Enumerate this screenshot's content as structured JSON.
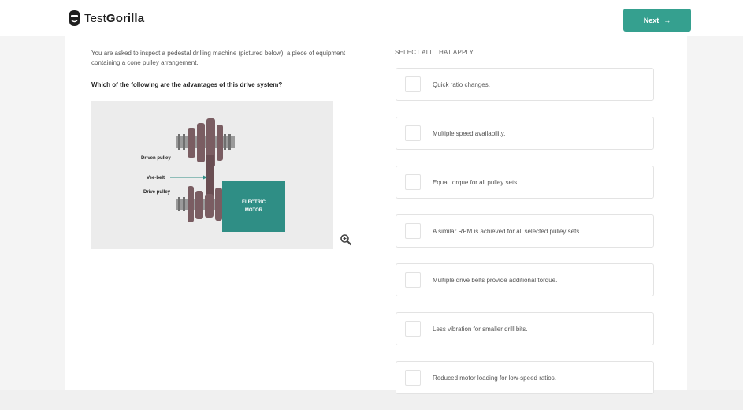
{
  "brand": {
    "prefix": "Test",
    "bold": "Gorilla"
  },
  "header": {
    "next_label": "Next"
  },
  "question": {
    "intro": "You are asked to inspect a pedestal drilling machine (pictured below), a piece of equipment containing a cone pulley arrangement.",
    "prompt": "Which of the following are the advantages of this drive system?"
  },
  "figure": {
    "labels": {
      "driven_pulley": "Driven pulley",
      "vee_belt": "Vee-belt",
      "drive_pulley": "Drive pulley",
      "motor_line1": "ELECTRIC",
      "motor_line2": "MOTOR"
    },
    "zoom_icon": "zoom-in-icon"
  },
  "answers": {
    "instruction": "SELECT ALL THAT APPLY",
    "options": [
      "Quick ratio changes.",
      "Multiple speed availability.",
      "Equal torque for all pulley sets.",
      "A similar RPM is achieved for all selected pulley sets.",
      "Multiple drive belts provide additional torque.",
      "Less vibration for smaller drill bits.",
      "Reduced motor loading for low-speed ratios."
    ]
  },
  "colors": {
    "accent": "#35a08f",
    "motor": "#2f8e85",
    "pulley": "#7a5d62"
  }
}
